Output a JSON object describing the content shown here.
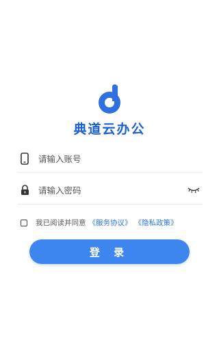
{
  "app": {
    "name": "典道云办公",
    "logo_icon": "music-note-logo",
    "brand_color": "#3d86f0"
  },
  "form": {
    "account_placeholder": "请输入账号",
    "account_icon": "phone-icon",
    "password_placeholder": "请输入密码",
    "password_icon": "lock-icon",
    "toggle_icon": "eye-closed-icon"
  },
  "agreement": {
    "checked": false,
    "prefix": "我已阅读并同意",
    "service_link": "《服务协议》",
    "privacy_link": "《隐私政策》"
  },
  "login_button_label": "登 录"
}
